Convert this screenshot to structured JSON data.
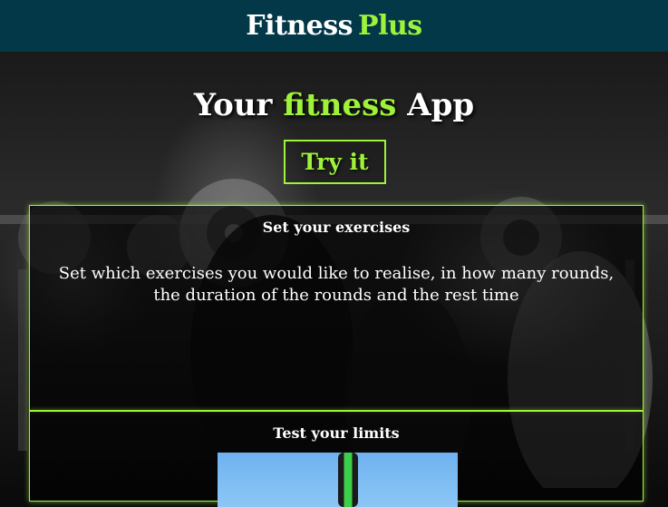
{
  "header": {
    "brand_main": "Fitness",
    "brand_accent": "Plus"
  },
  "hero": {
    "headline_pre": "Your",
    "headline_accent": "fitness",
    "headline_post": "App",
    "cta_label": "Try it"
  },
  "cards": [
    {
      "title": "Set your exercises",
      "text": "Set which exercises you would like to realise, in how many rounds, the duration of the rounds and the rest time"
    },
    {
      "title": "Test your limits"
    }
  ],
  "colors": {
    "header_bg": "#033848",
    "accent": "#9ff23a",
    "text": "#ffffff"
  }
}
